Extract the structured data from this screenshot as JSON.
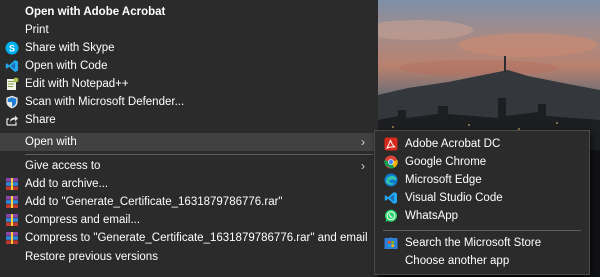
{
  "context_menu": {
    "items": [
      {
        "label": "Open with Adobe Acrobat",
        "icon": "none"
      },
      {
        "label": "Print",
        "icon": "none"
      },
      {
        "label": "Share with Skype",
        "icon": "skype-icon"
      },
      {
        "label": "Open with Code",
        "icon": "vscode-icon"
      },
      {
        "label": "Edit with Notepad++",
        "icon": "notepad-plus-plus-icon"
      },
      {
        "label": "Scan with Microsoft Defender...",
        "icon": "defender-shield-icon"
      },
      {
        "label": "Share",
        "icon": "share-icon"
      },
      {
        "label": "Open with",
        "icon": "none"
      },
      {
        "label": "Give access to",
        "icon": "none"
      },
      {
        "label": "Add to archive...",
        "icon": "winrar-icon"
      },
      {
        "label": "Add to \"Generate_Certificate_1631879786776.rar\"",
        "icon": "winrar-icon"
      },
      {
        "label": "Compress and email...",
        "icon": "winrar-icon"
      },
      {
        "label": "Compress to \"Generate_Certificate_1631879786776.rar\" and email",
        "icon": "winrar-icon"
      },
      {
        "label": "Restore previous versions",
        "icon": "none"
      }
    ],
    "submenu_arrow": "›"
  },
  "open_with_submenu": {
    "items": [
      {
        "label": "Adobe Acrobat DC",
        "icon": "acrobat-icon"
      },
      {
        "label": "Google Chrome",
        "icon": "chrome-icon"
      },
      {
        "label": "Microsoft Edge",
        "icon": "edge-icon"
      },
      {
        "label": "Visual Studio Code",
        "icon": "vscode-icon"
      },
      {
        "label": "WhatsApp",
        "icon": "whatsapp-icon"
      },
      {
        "label": "Search the Microsoft Store",
        "icon": "microsoft-store-icon"
      },
      {
        "label": "Choose another app",
        "icon": "none"
      }
    ]
  },
  "colors": {
    "menu_background": "#2b2b2b",
    "menu_hover": "#414141",
    "separator": "#5d5d5d",
    "text": "#ffffff"
  }
}
